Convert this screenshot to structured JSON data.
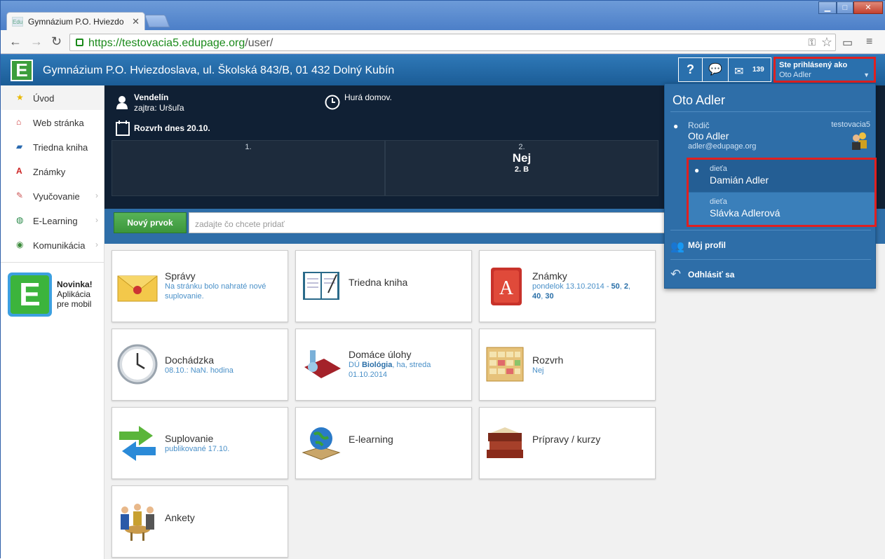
{
  "browser": {
    "tab_title": "Gymnázium P.O. Hviezdo",
    "favicon": "Edu",
    "url_secure": "https://testovacia5.edupage.org",
    "url_path": "/user/"
  },
  "header": {
    "logo_letter": "E",
    "school_name": "Gymnázium P.O. Hviezdoslava, ul. Školská 843/B, 01 432 Dolný Kubín",
    "help_label": "?",
    "message_count": "139",
    "user_caption": "Ste prihlásený ako",
    "user_name": "Oto Adler"
  },
  "sidebar": {
    "items": [
      {
        "label": "Úvod",
        "icon": "star-icon"
      },
      {
        "label": "Web stránka",
        "icon": "house-icon"
      },
      {
        "label": "Triedna kniha",
        "icon": "book-icon"
      },
      {
        "label": "Známky",
        "icon": "grades-icon"
      },
      {
        "label": "Vyučovanie",
        "icon": "teaching-icon"
      },
      {
        "label": "E-Learning",
        "icon": "globe-icon"
      },
      {
        "label": "Komunikácia",
        "icon": "communication-icon"
      }
    ],
    "promo": {
      "title": "Novinka!",
      "line1": "Aplikácia",
      "line2": "pre mobil",
      "logo_letter": "E"
    }
  },
  "today": {
    "nameday": "Vendelín",
    "tomorrow": "zajtra: Uršuľa",
    "status": "Hurá domov.",
    "schedule_title": "Rozvrh dnes 20.10.",
    "periods": [
      {
        "num": "1.",
        "subject": "",
        "class": ""
      },
      {
        "num": "2.",
        "subject": "Nej",
        "class": "2. B"
      }
    ]
  },
  "add": {
    "button_label": "Nový prvok",
    "placeholder": "zadajte čo chcete pridať"
  },
  "cards": {
    "spravy": {
      "title": "Správy",
      "sub": "Na stránku bolo nahraté nové suplovanie."
    },
    "triedna": {
      "title": "Triedna kniha"
    },
    "znamky": {
      "title": "Známky",
      "sub_prefix": "pondelok 13.10.2014 - ",
      "g1": "50",
      "g2": "2",
      "g3": "40",
      "g4": "30"
    },
    "dochadzka": {
      "title": "Dochádzka",
      "sub": "08.10.: NaN. hodina"
    },
    "ulohy": {
      "title": "Domáce úlohy",
      "sub_prefix": "DÚ ",
      "subject": "Biológia",
      "sub_rest": ", ha, streda",
      "date": "01.10.2014"
    },
    "rozvrh": {
      "title": "Rozvrh",
      "sub": "Nej"
    },
    "suplovanie": {
      "title": "Suplovanie",
      "sub": "publikované 17.10."
    },
    "elearning": {
      "title": "E-learning"
    },
    "pripravy": {
      "title": "Prípravy / kurzy"
    },
    "ankety": {
      "title": "Ankety"
    }
  },
  "dropdown": {
    "name": "Oto Adler",
    "parent_role": "Rodič",
    "parent_name": "Oto Adler",
    "parent_email": "adler@edupage.org",
    "domain": "testovacia5",
    "children": [
      {
        "role": "dieťa",
        "name": "Damián Adler"
      },
      {
        "role": "dieťa",
        "name": "Slávka Adlerová"
      }
    ],
    "profile_label": "Môj profil",
    "logout_label": "Odhlásiť sa"
  },
  "colors": {
    "header": "#1b5c96",
    "accent_green": "#3c963c",
    "highlight_red": "#e02020",
    "dark_panel": "#102034"
  }
}
